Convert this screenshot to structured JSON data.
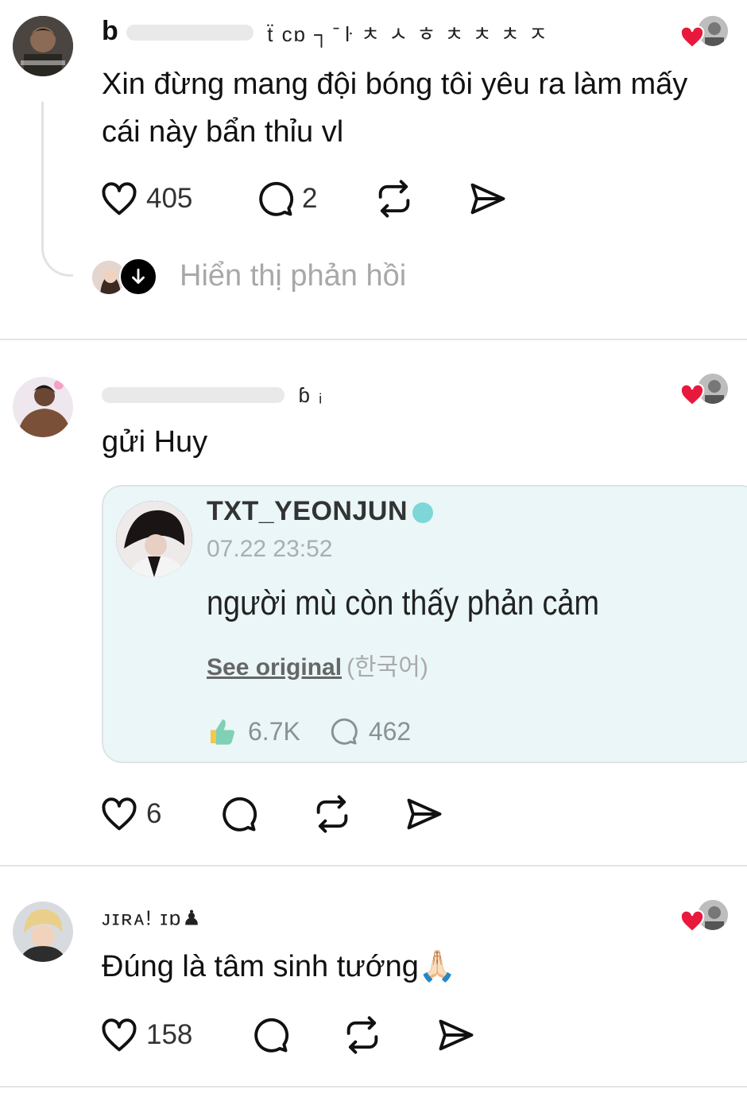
{
  "posts": [
    {
      "username_visible": "b",
      "username_scribble": "ẗ cɒ        ┐ ̄ ŀ ㅊ ㅅ ㅎ ㅊ ㅊ ㅊ ㅈ",
      "text_lines": [
        "Xin đừng mang đội bóng tôi yêu ra làm mấy",
        "cái này bẩn thỉu vl"
      ],
      "likes": "405",
      "replies": "2",
      "show_replies_label": "Hiển thị phản hồi"
    },
    {
      "username_scribble": "ɓ  ᵢ",
      "text": "gửi Huy",
      "embed": {
        "name": "TXT_YEONJUN",
        "date": "07.22 23:52",
        "text": "người mù còn thấy phản cảm",
        "see_original": "See original",
        "lang": "(한국어)",
        "likes": "6.7K",
        "comments": "462"
      },
      "likes": "6"
    },
    {
      "username_scribble": "ᴊɪʀᴀ!  ɪɒ♟",
      "text": "Đúng là tâm sinh tướng🙏🏻",
      "likes": "158"
    }
  ],
  "colors": {
    "heart_red": "#e8193c",
    "muted_text": "#a8a8a8",
    "divider": "#e4e4e4",
    "embed_bg": "#eaf6f8"
  },
  "icons": [
    "heart-icon",
    "comment-icon",
    "repost-icon",
    "share-icon",
    "down-arrow-icon"
  ]
}
